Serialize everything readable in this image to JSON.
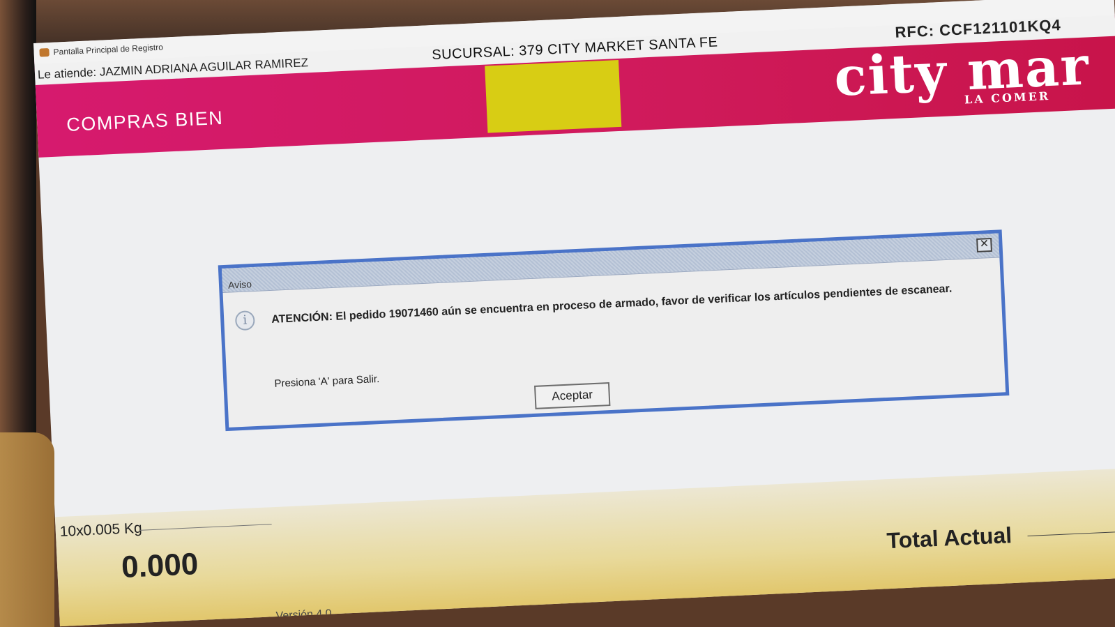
{
  "window": {
    "title": "Pantalla Principal de Registro"
  },
  "header": {
    "attendant": "Le atiende: JAZMIN ADRIANA AGUILAR RAMIREZ",
    "branch": "SUCURSAL: 379 CITY MARKET SANTA FE",
    "rfc": "RFC: CCF121101KQ4",
    "store_title": "COMPRAS BIEN",
    "logo": "city mar",
    "logo_sub": "LA COMER",
    "brand_color": "#d61a6e",
    "yellow_accent": "#d8cd14"
  },
  "dialog": {
    "title": "Aviso",
    "message": "ATENCIÓN: El pedido 19071460 aún se encuentra en proceso de armado, favor de verificar los artículos pendientes de escanear.",
    "hint": "Presiona 'A' para Salir.",
    "accept_label": "Aceptar",
    "icon": "info-icon",
    "close_icon": "close-icon",
    "border_color": "#4a73c8"
  },
  "bottom": {
    "scale_label": "10x0.005 Kg",
    "weight": "0.000",
    "total_label": "Total Actual",
    "version": "Versión 4.0"
  }
}
